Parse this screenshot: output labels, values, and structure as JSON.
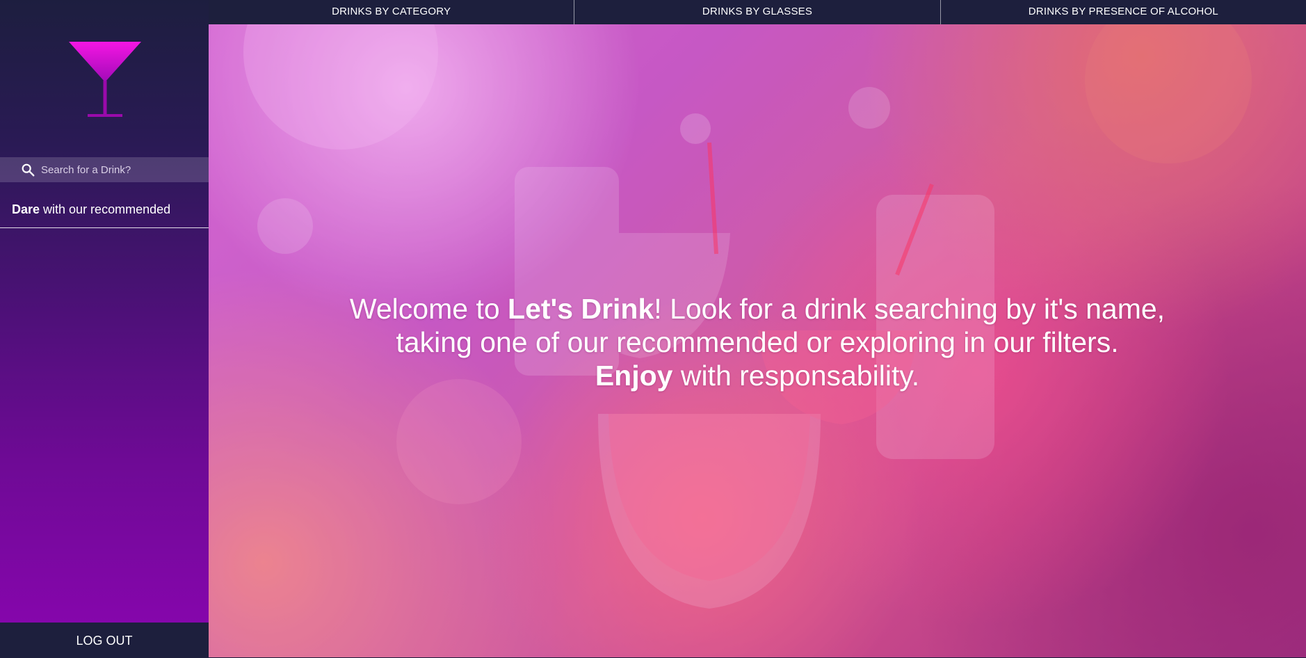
{
  "topnav": {
    "items": [
      {
        "label": "DRINKS BY CATEGORY"
      },
      {
        "label": "DRINKS BY GLASSES"
      },
      {
        "label": "DRINKS BY PRESENCE OF ALCOHOL"
      }
    ]
  },
  "sidebar": {
    "logo_icon": "cocktail-glass-icon",
    "search": {
      "icon": "search-icon",
      "placeholder": "Search for a Drink?",
      "value": ""
    },
    "recommended": {
      "bold": "Dare",
      "rest": " with our recommended"
    },
    "logout_label": "LOG OUT"
  },
  "hero": {
    "line1": {
      "a": "Welcome to ",
      "b": "Let's Drink",
      "c": "! Look for a drink searching by it's name,"
    },
    "line2": "taking one of our recommended or exploring in our filters.",
    "line3": {
      "a": "Enjoy",
      "b": " with responsability."
    }
  },
  "colors": {
    "nav_bg": "#1d1f3d",
    "logo": "#e50fd9",
    "sidebar_gradient_bottom": "#8a05b0"
  }
}
